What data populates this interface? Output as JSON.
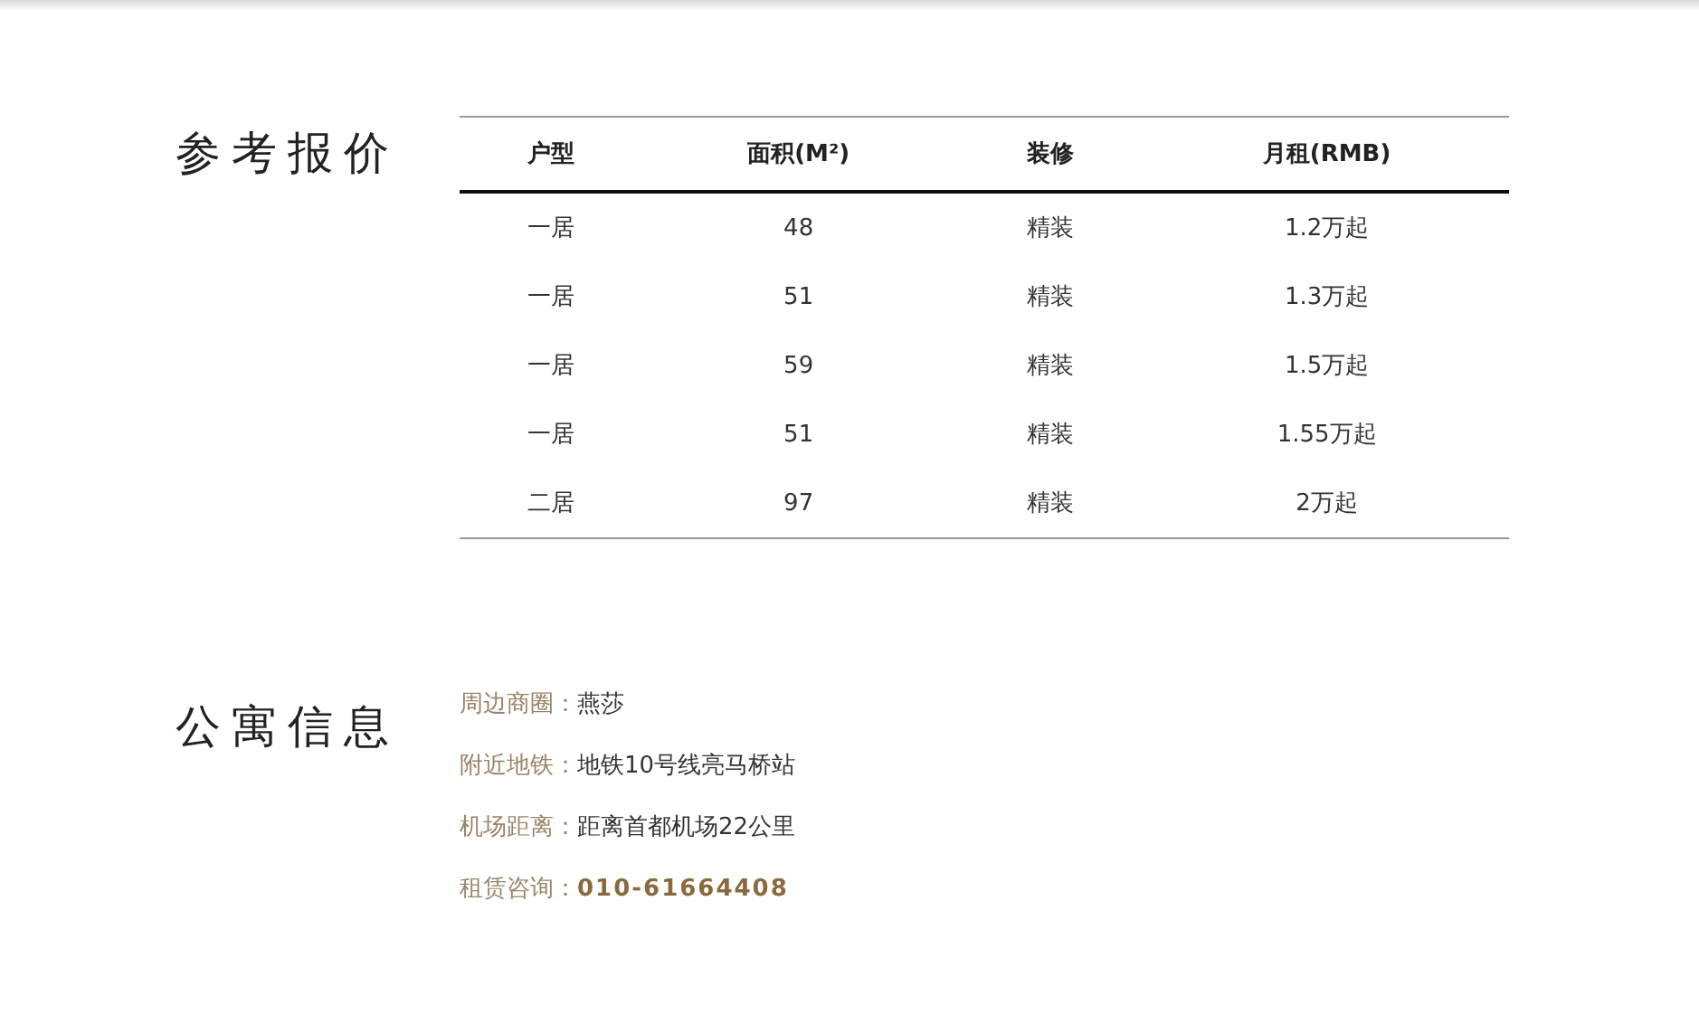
{
  "price_section": {
    "title": "参考报价",
    "table": {
      "columns": [
        "户型",
        "面积(M²)",
        "装修",
        "月租(RMB)"
      ],
      "rows": [
        [
          "一居",
          "48",
          "精装",
          "1.2万起"
        ],
        [
          "一居",
          "51",
          "精装",
          "1.3万起"
        ],
        [
          "一居",
          "59",
          "精装",
          "1.5万起"
        ],
        [
          "一居",
          "51",
          "精装",
          "1.55万起"
        ],
        [
          "二居",
          "97",
          "精装",
          "2万起"
        ]
      ]
    }
  },
  "info_section": {
    "title": "公寓信息",
    "items": [
      {
        "kind": "text",
        "label": "周边商圈：",
        "value": "燕莎"
      },
      {
        "kind": "text",
        "label": "附近地铁：",
        "value": "地铁10号线亮马桥站"
      },
      {
        "kind": "text",
        "label": "机场距离：",
        "value": "距离首都机场22公里"
      },
      {
        "kind": "phone",
        "label": "租赁咨询：",
        "value": "010-61664408"
      }
    ]
  }
}
